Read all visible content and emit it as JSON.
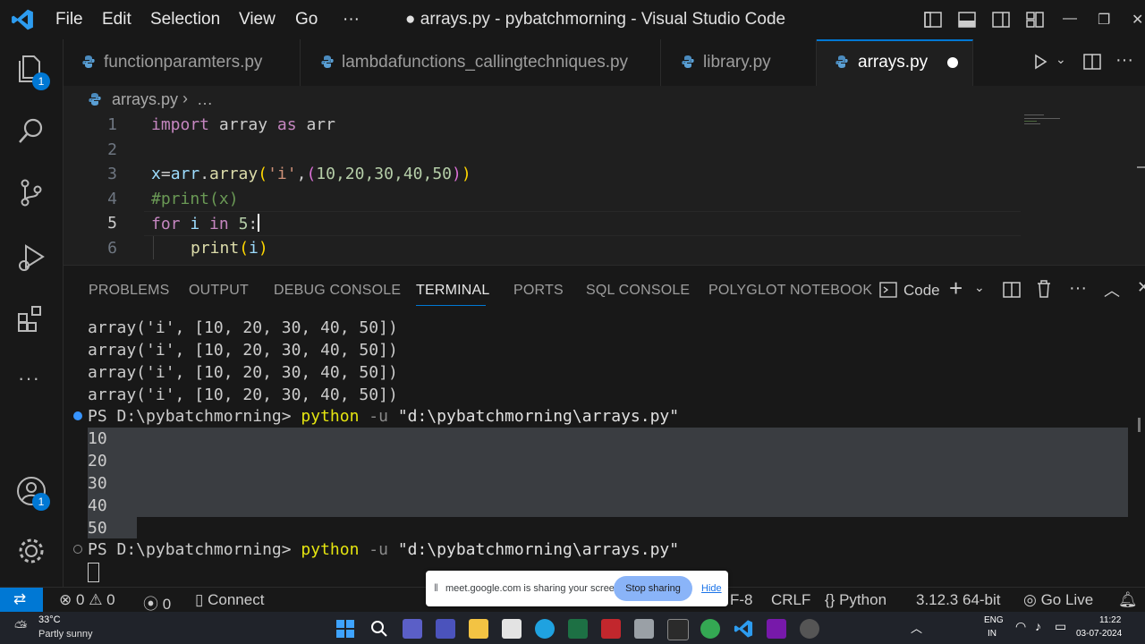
{
  "window": {
    "title": "● arrays.py - pybatchmorning - Visual Studio Code",
    "menu": [
      "File",
      "Edit",
      "Selection",
      "View",
      "Go",
      "···"
    ]
  },
  "activity_bar": {
    "explorer_badge": "1",
    "accounts_badge": "1"
  },
  "tabs": [
    {
      "label": "functionparamters.py",
      "active": false
    },
    {
      "label": "lambdafunctions_callingtechniques.py",
      "active": false
    },
    {
      "label": "library.py",
      "active": false
    },
    {
      "label": "arrays.py",
      "active": true,
      "modified": true
    }
  ],
  "breadcrumb": {
    "file": "arrays.py",
    "rest": "…"
  },
  "editor": {
    "line_numbers": [
      "1",
      "2",
      "3",
      "4",
      "5",
      "6"
    ],
    "current_line": 5,
    "lines": {
      "l1_kw": "import",
      "l1_mod": "array",
      "l1_as": "as",
      "l1_alias": "arr",
      "l3_x": "x",
      "l3_eq": "=",
      "l3_arr": "arr",
      "l3_dot": ".",
      "l3_fn": "array",
      "l3_open": "(",
      "l3_str": "'i'",
      "l3_comma": ",",
      "l3_open2": "(",
      "l3_nums": "10,20,30,40,50",
      "l3_close2": ")",
      "l3_close": ")",
      "l4_comment": "#print(x)",
      "l5_for": "for",
      "l5_i": "i",
      "l5_in": "in",
      "l5_num": "5",
      "l5_colon": ":",
      "l6_fn": "print",
      "l6_open": "(",
      "l6_i": "i",
      "l6_close": ")"
    }
  },
  "panel": {
    "tabs": [
      "PROBLEMS",
      "OUTPUT",
      "DEBUG CONSOLE",
      "TERMINAL",
      "PORTS",
      "SQL CONSOLE",
      "POLYGLOT NOTEBOOK"
    ],
    "active_tab": "TERMINAL",
    "shell_label": "Code",
    "terminal": {
      "output_lines": [
        "array('i', [10, 20, 30, 40, 50])",
        "array('i', [10, 20, 30, 40, 50])",
        "array('i', [10, 20, 30, 40, 50])",
        "array('i', [10, 20, 30, 40, 50])"
      ],
      "prompt": "PS D:\\pybatchmorning>",
      "cmd": "python",
      "flag": "-u",
      "path": "\"d:\\pybatchmorning\\arrays.py\"",
      "values": [
        "10",
        "20",
        "30",
        "40",
        "50"
      ]
    }
  },
  "status_bar": {
    "errors": "0",
    "warnings": "0",
    "ports": "0",
    "connect": "Connect",
    "encoding": "F-8",
    "eol": "CRLF",
    "language": "Python",
    "interpreter": "3.12.3 64-bit",
    "golive": "Go Live"
  },
  "share_banner": {
    "message": "meet.google.com is sharing your screen.",
    "stop": "Stop sharing",
    "hide": "Hide"
  },
  "taskbar": {
    "weather_temp": "33°C",
    "weather_desc": "Partly sunny",
    "lang_top": "ENG",
    "lang_bottom": "IN",
    "time": "11:22",
    "date": "03-07-2024"
  },
  "colors": {
    "accent": "#0078d4",
    "keyword": "#c586c0",
    "function": "#dcdcaa",
    "string": "#ce9178",
    "comment": "#6a9955"
  }
}
